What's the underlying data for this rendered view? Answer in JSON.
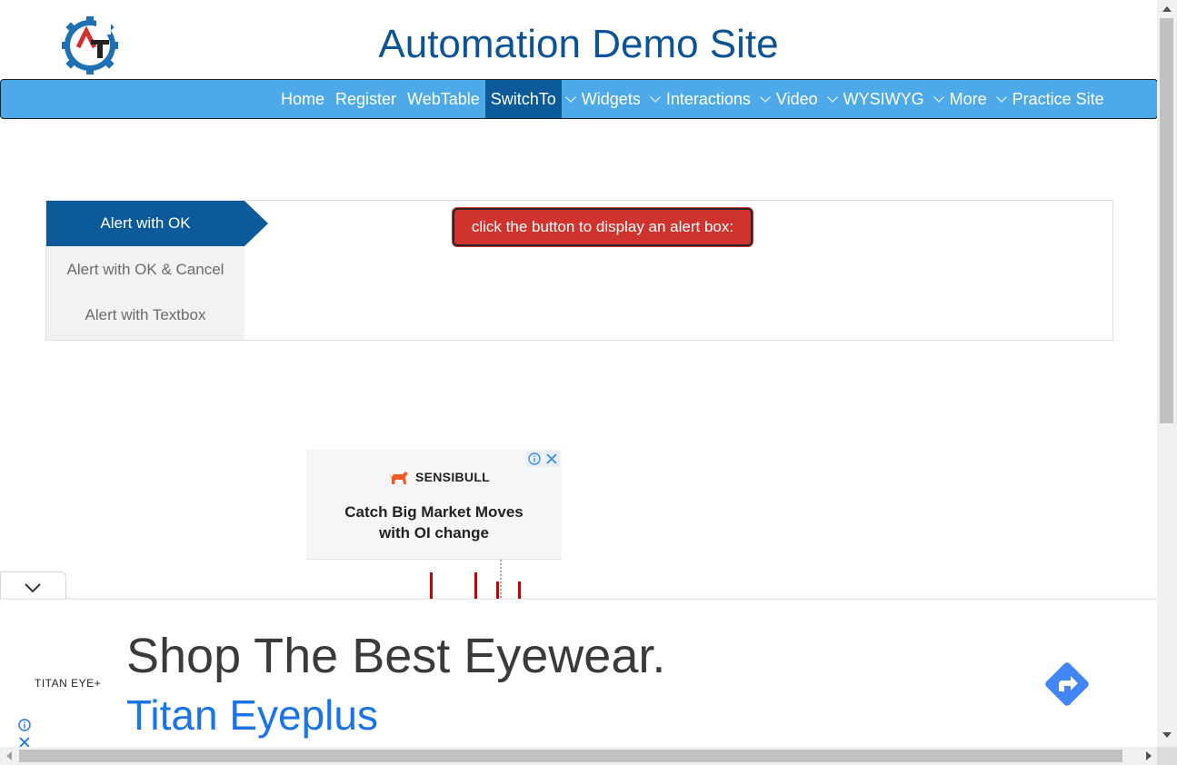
{
  "header": {
    "site_title": "Automation Demo Site",
    "logo_letters": "AT",
    "colors": {
      "title": "#0b5394",
      "logo_gear": "#1f6fb5",
      "logo_a": "#d0332d"
    }
  },
  "nav": {
    "items": [
      {
        "label": "Home",
        "has_dropdown": false,
        "active": false
      },
      {
        "label": "Register",
        "has_dropdown": false,
        "active": false
      },
      {
        "label": "WebTable",
        "has_dropdown": false,
        "active": false
      },
      {
        "label": "SwitchTo",
        "has_dropdown": true,
        "active": true
      },
      {
        "label": "Widgets",
        "has_dropdown": true,
        "active": false
      },
      {
        "label": "Interactions",
        "has_dropdown": true,
        "active": false
      },
      {
        "label": "Video",
        "has_dropdown": true,
        "active": false
      },
      {
        "label": "WYSIWYG",
        "has_dropdown": true,
        "active": false
      },
      {
        "label": "More",
        "has_dropdown": true,
        "active": false
      },
      {
        "label": "Practice Site",
        "has_dropdown": false,
        "active": false
      }
    ],
    "colors": {
      "bar": "#4ea9e8",
      "active": "#0c5a9a"
    }
  },
  "alerts": {
    "tabs": [
      {
        "label": "Alert with OK",
        "active": true
      },
      {
        "label": "Alert with OK & Cancel",
        "active": false
      },
      {
        "label": "Alert with Textbox",
        "active": false
      }
    ],
    "button_label": "click the button to display an alert box:",
    "button_color": "#d0332d"
  },
  "square_ad": {
    "brand": "SENSIBULL",
    "headline_line1": "Catch Big Market Moves",
    "headline_line2": "with OI change",
    "icons": [
      "info-icon",
      "close-icon"
    ]
  },
  "bottom_ad": {
    "brand": "TITAN EYE+",
    "headline": "Shop The Best Eyewear.",
    "subline": "Titan Eyeplus",
    "colors": {
      "subline": "#1a73e8",
      "go_button": "#4285f4"
    }
  }
}
